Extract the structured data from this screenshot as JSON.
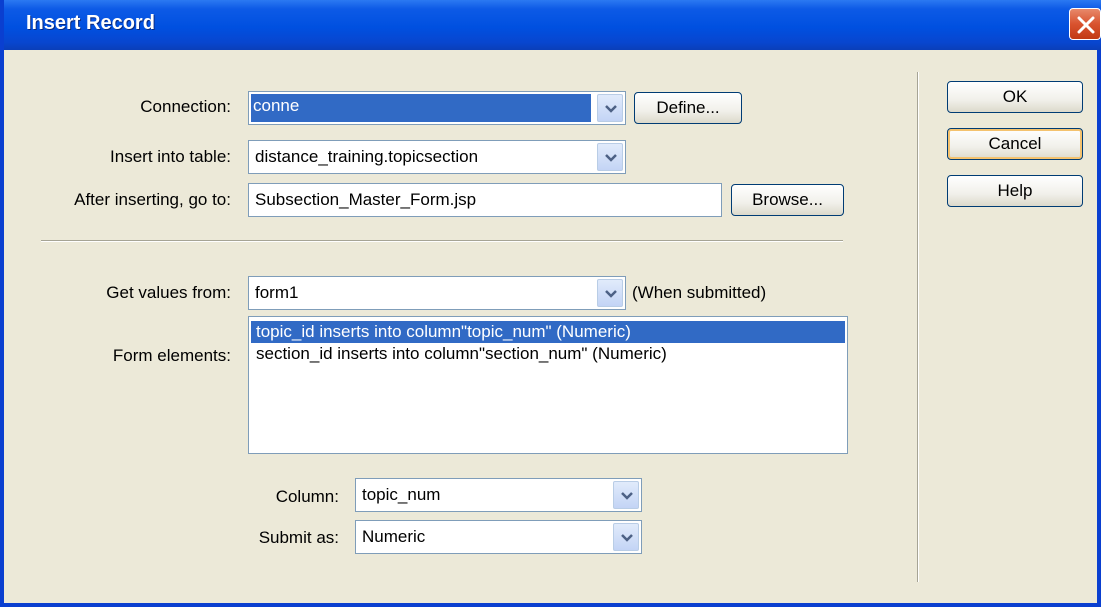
{
  "dialog": {
    "title": "Insert Record"
  },
  "form": {
    "connection": {
      "label": "Connection:",
      "value": "conne",
      "button": "Define..."
    },
    "insert_table": {
      "label": "Insert into table:",
      "value": "distance_training.topicsection"
    },
    "after_insert": {
      "label": "After inserting, go to:",
      "value": "Subsection_Master_Form.jsp",
      "button": "Browse..."
    },
    "get_values": {
      "label": "Get values from:",
      "value": "form1",
      "note": "(When submitted)"
    },
    "form_elements": {
      "label": "Form elements:",
      "items": [
        "topic_id inserts into column\"topic_num\" (Numeric)",
        "section_id inserts into column\"section_num\" (Numeric)"
      ],
      "selected_index": 0
    },
    "column": {
      "label": "Column:",
      "value": "topic_num"
    },
    "submit_as": {
      "label": "Submit as:",
      "value": "Numeric"
    }
  },
  "buttons": {
    "ok": "OK",
    "cancel": "Cancel",
    "help": "Help"
  }
}
